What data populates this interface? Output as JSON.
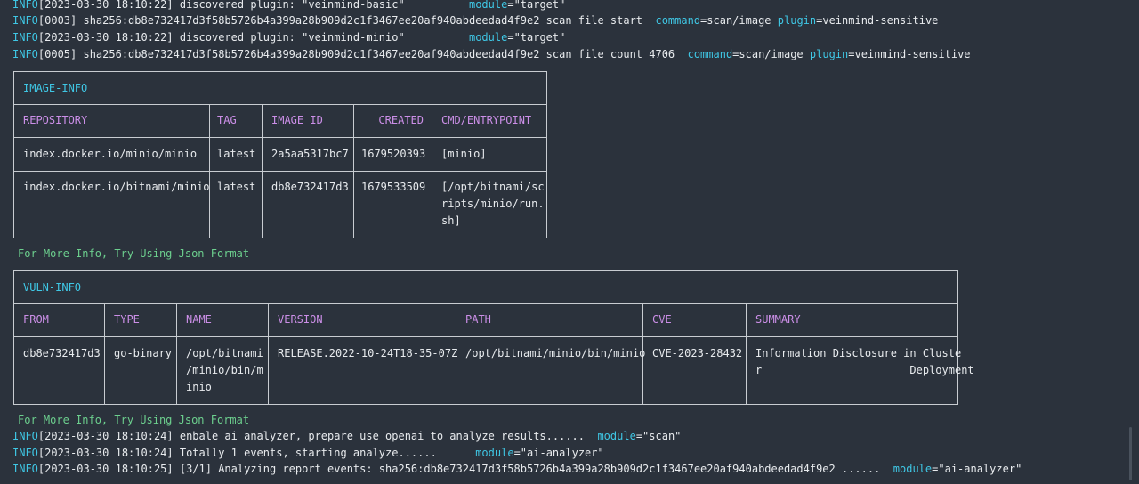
{
  "log_top": [
    {
      "level": "INFO",
      "body": "[2023-03-30 18:10:22] discovered plugin: \"veinmind-basic\"",
      "pad": "          ",
      "kv": [
        {
          "k": "module",
          "v": "\"target\""
        }
      ]
    },
    {
      "level": "INFO",
      "body": "[0003] sha256:db8e732417d3f58b5726b4a399a28b909d2c1f3467ee20af940abdeedad4f9e2 scan file start  ",
      "pad": "",
      "kv": [
        {
          "k": "command",
          "v": "scan/image"
        },
        {
          "k": "plugin",
          "v": "veinmind-sensitive"
        }
      ]
    },
    {
      "level": "INFO",
      "body": "[2023-03-30 18:10:22] discovered plugin: \"veinmind-minio\"",
      "pad": "          ",
      "kv": [
        {
          "k": "module",
          "v": "\"target\""
        }
      ]
    },
    {
      "level": "INFO",
      "body": "[0005] sha256:db8e732417d3f58b5726b4a399a28b909d2c1f3467ee20af940abdeedad4f9e2 scan file count 4706  ",
      "pad": "",
      "kv": [
        {
          "k": "command",
          "v": "scan/image"
        },
        {
          "k": "plugin",
          "v": "veinmind-sensitive"
        }
      ]
    }
  ],
  "image_info": {
    "caption": "IMAGE-INFO",
    "headers": [
      "REPOSITORY",
      "TAG",
      "IMAGE ID",
      "CREATED",
      "CMD/ENTRYPOINT"
    ],
    "rows": [
      [
        "index.docker.io/minio/minio",
        "latest",
        "2a5aa5317bc7",
        "1679520393",
        "[minio]"
      ],
      [
        "index.docker.io/bitnami/minio",
        "latest",
        "db8e732417d3",
        "1679533509",
        "[/opt/bitnami/sc\nripts/minio/run.\nsh]"
      ]
    ]
  },
  "hint_1": "For More Info, Try Using Json Format",
  "vuln_info": {
    "caption": "VULN-INFO",
    "headers": [
      "FROM",
      "TYPE",
      "NAME",
      "VERSION",
      "PATH",
      "CVE",
      "SUMMARY"
    ],
    "rows": [
      [
        "db8e732417d3",
        "go-binary",
        "/opt/bitnami\n/minio/bin/m\ninio",
        "RELEASE.2022-10-24T18-35-07Z",
        "/opt/bitnami/minio/bin/minio",
        "CVE-2023-28432",
        "Information Disclosure in Cluste\nr                       Deployment"
      ]
    ]
  },
  "hint_2": "For More Info, Try Using Json Format",
  "log_bottom": [
    {
      "level": "INFO",
      "body": "[2023-03-30 18:10:24] enbale ai analyzer, prepare use openai to analyze results......  ",
      "pad": "",
      "kv": [
        {
          "k": "module",
          "v": "\"scan\""
        }
      ]
    },
    {
      "level": "INFO",
      "body": "[2023-03-30 18:10:24] Totally 1 events, starting analyze......",
      "pad": "      ",
      "kv": [
        {
          "k": "module",
          "v": "\"ai-analyzer\""
        }
      ]
    },
    {
      "level": "INFO",
      "body": "[2023-03-30 18:10:25] [3/1] Analyzing report events: sha256:db8e732417d3f58b5726b4a399a28b909d2c1f3467ee20af940abdeedad4f9e2 ......  ",
      "pad": "",
      "kv": [
        {
          "k": "module",
          "v": "\"ai-analyzer\""
        }
      ]
    }
  ]
}
